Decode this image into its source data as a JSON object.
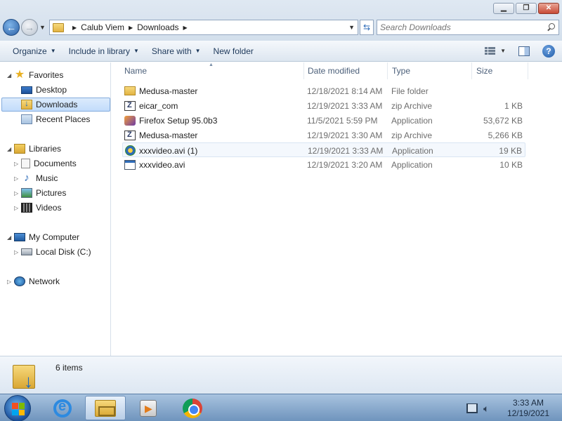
{
  "window": {
    "minimize_label": "▁",
    "maximize_label": "❐",
    "close_label": "✕"
  },
  "address": {
    "crumbs": [
      "Calub Viem",
      "Downloads"
    ],
    "refresh_icon": "refresh-icon"
  },
  "search": {
    "placeholder": "Search Downloads"
  },
  "toolbar": {
    "organize": "Organize",
    "include_in_library": "Include in library",
    "share_with": "Share with",
    "new_folder": "New folder"
  },
  "sidebar": {
    "favorites": {
      "label": "Favorites",
      "items": [
        {
          "label": "Desktop"
        },
        {
          "label": "Downloads"
        },
        {
          "label": "Recent Places"
        }
      ]
    },
    "libraries": {
      "label": "Libraries",
      "items": [
        {
          "label": "Documents"
        },
        {
          "label": "Music"
        },
        {
          "label": "Pictures"
        },
        {
          "label": "Videos"
        }
      ]
    },
    "computer": {
      "label": "My Computer",
      "items": [
        {
          "label": "Local Disk (C:)"
        }
      ]
    },
    "network": {
      "label": "Network"
    }
  },
  "columns": {
    "name": "Name",
    "date_modified": "Date modified",
    "type": "Type",
    "size": "Size"
  },
  "files": [
    {
      "name": "Medusa-master",
      "date": "12/18/2021 8:14 AM",
      "type": "File folder",
      "size": "",
      "icon": "folder-icon"
    },
    {
      "name": "eicar_com",
      "date": "12/19/2021 3:33 AM",
      "type": "zip Archive",
      "size": "1 KB",
      "icon": "zip-icon"
    },
    {
      "name": "Firefox Setup 95.0b3",
      "date": "11/5/2021 5:59 PM",
      "type": "Application",
      "size": "53,672 KB",
      "icon": "firefox-installer-icon"
    },
    {
      "name": "Medusa-master",
      "date": "12/19/2021 3:30 AM",
      "type": "zip Archive",
      "size": "5,266 KB",
      "icon": "zip-icon"
    },
    {
      "name": "xxxvideo.avi (1)",
      "date": "12/19/2021 3:33 AM",
      "type": "Application",
      "size": "19 KB",
      "icon": "media-app-icon"
    },
    {
      "name": "xxxvideo.avi",
      "date": "12/19/2021 3:20 AM",
      "type": "Application",
      "size": "10 KB",
      "icon": "app-icon"
    }
  ],
  "status": {
    "item_count": "6 items"
  },
  "taskbar": {
    "time": "3:33 AM",
    "date": "12/19/2021"
  }
}
